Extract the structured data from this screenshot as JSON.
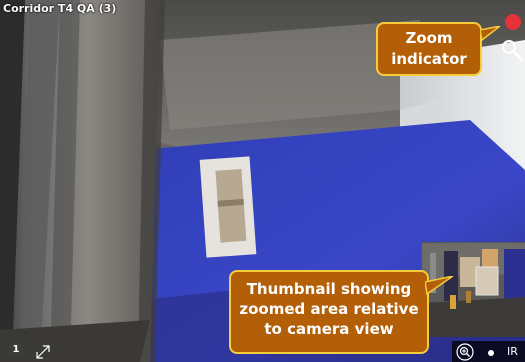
{
  "camera": {
    "title": "Corridor T4 QA (3)"
  },
  "overlay": {
    "viewport_number": "1",
    "ir_label": "IR"
  },
  "callouts": {
    "zoom_indicator": "Zoom\nindicator",
    "thumbnail": "Thumbnail showing\nzoomed area relative\nto camera view"
  },
  "colors": {
    "recording_dot": "#e6323a",
    "callout_fill": "#b35f07",
    "callout_border": "#f5cc3c"
  },
  "icons": {
    "zoom_search": "magnifier-icon",
    "expand": "expand-diagonal-icon",
    "zoom_button": "zoom-in-circle-icon"
  }
}
